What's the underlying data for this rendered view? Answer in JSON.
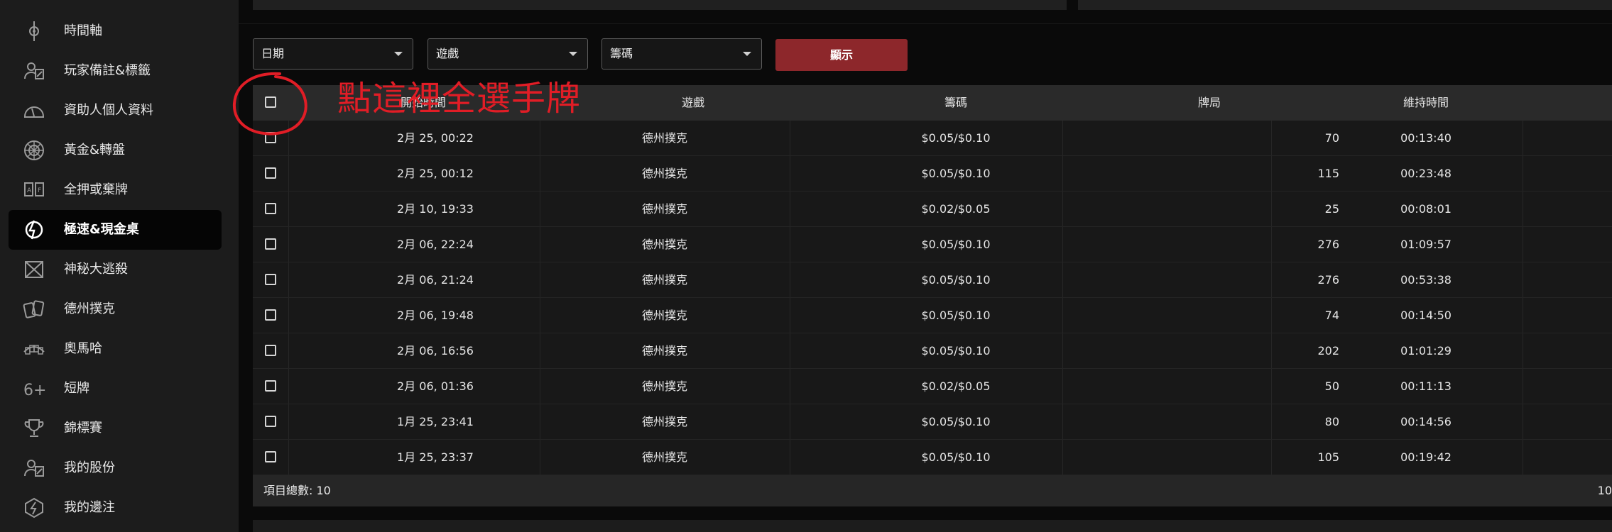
{
  "sidebar": {
    "items": [
      {
        "label": "時間軸",
        "icon": "timeline-icon"
      },
      {
        "label": "玩家備註&標籤",
        "icon": "player-notes-icon"
      },
      {
        "label": "資助人個人資料",
        "icon": "gauge-icon"
      },
      {
        "label": "黃金&轉盤",
        "icon": "wheel-icon"
      },
      {
        "label": "全押或棄牌",
        "icon": "allin-fold-icon"
      },
      {
        "label": "極速&現金桌",
        "icon": "rush-cash-icon",
        "active": true
      },
      {
        "label": "神秘大逃殺",
        "icon": "mystery-battle-icon"
      },
      {
        "label": "德州撲克",
        "icon": "cards-icon"
      },
      {
        "label": "奧馬哈",
        "icon": "omaha-cards-icon"
      },
      {
        "label": "短牌",
        "icon": "six-plus-icon"
      },
      {
        "label": "錦標賽",
        "icon": "trophy-icon"
      },
      {
        "label": "我的股份",
        "icon": "my-stakes-icon"
      },
      {
        "label": "我的邊注",
        "icon": "side-bet-icon"
      }
    ]
  },
  "filters": {
    "date": "日期",
    "game": "遊戲",
    "stakes": "籌碼",
    "show_button": "顯示"
  },
  "table": {
    "headers": {
      "start_time": "開始時間",
      "game": "遊戲",
      "stakes": "籌碼",
      "hands": "牌局",
      "duration": "維持時間"
    },
    "rows": [
      {
        "start_time": "2月 25, 00:22",
        "game": "德州撲克",
        "stakes": "$0.05/$0.10",
        "hands": "70",
        "duration": "00:13:40"
      },
      {
        "start_time": "2月 25, 00:12",
        "game": "德州撲克",
        "stakes": "$0.05/$0.10",
        "hands": "115",
        "duration": "00:23:48"
      },
      {
        "start_time": "2月 10, 19:33",
        "game": "德州撲克",
        "stakes": "$0.02/$0.05",
        "hands": "25",
        "duration": "00:08:01"
      },
      {
        "start_time": "2月 06, 22:24",
        "game": "德州撲克",
        "stakes": "$0.05/$0.10",
        "hands": "276",
        "duration": "01:09:57"
      },
      {
        "start_time": "2月 06, 21:24",
        "game": "德州撲克",
        "stakes": "$0.05/$0.10",
        "hands": "276",
        "duration": "00:53:38"
      },
      {
        "start_time": "2月 06, 19:48",
        "game": "德州撲克",
        "stakes": "$0.05/$0.10",
        "hands": "74",
        "duration": "00:14:50"
      },
      {
        "start_time": "2月 06, 16:56",
        "game": "德州撲克",
        "stakes": "$0.05/$0.10",
        "hands": "202",
        "duration": "01:01:29"
      },
      {
        "start_time": "2月 06, 01:36",
        "game": "德州撲克",
        "stakes": "$0.02/$0.05",
        "hands": "50",
        "duration": "00:11:13"
      },
      {
        "start_time": "1月 25, 23:41",
        "game": "德州撲克",
        "stakes": "$0.05/$0.10",
        "hands": "80",
        "duration": "00:14:56"
      },
      {
        "start_time": "1月 25, 23:37",
        "game": "德州撲克",
        "stakes": "$0.05/$0.10",
        "hands": "105",
        "duration": "00:19:42"
      }
    ],
    "footer_total": "項目總數: 10",
    "footer_pager": "10"
  },
  "annotation": {
    "text": "點這裡全選手牌",
    "color": "#e11d26"
  },
  "colors": {
    "accent_button": "#8d272b",
    "sidebar_bg": "#1c1c1c",
    "active_item_bg": "#050505"
  }
}
